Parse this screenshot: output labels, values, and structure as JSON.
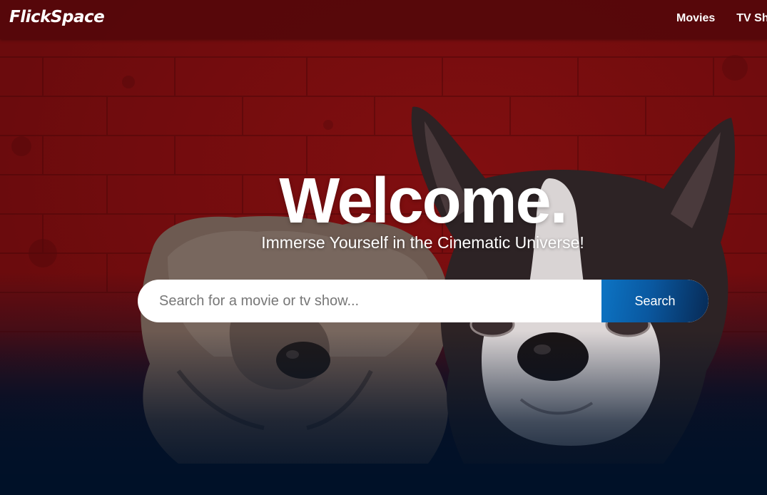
{
  "navbar": {
    "brand": "FlickSpace",
    "links": [
      "Movies",
      "TV Shows"
    ]
  },
  "hero": {
    "title": "Welcome.",
    "subtitle": "Immerse Yourself in the Cinematic Universe!",
    "background_image": "two-dogs-photo",
    "search": {
      "placeholder": "Search for a movie or tv show...",
      "value": "",
      "button_label": "Search"
    }
  },
  "colors": {
    "navbar_bg": "#5a0a0c",
    "hero_red": "#7e0d0f",
    "page_bottom": "#001128",
    "button_start": "#0c74c4",
    "button_end": "#072a55",
    "text": "#ffffff"
  }
}
